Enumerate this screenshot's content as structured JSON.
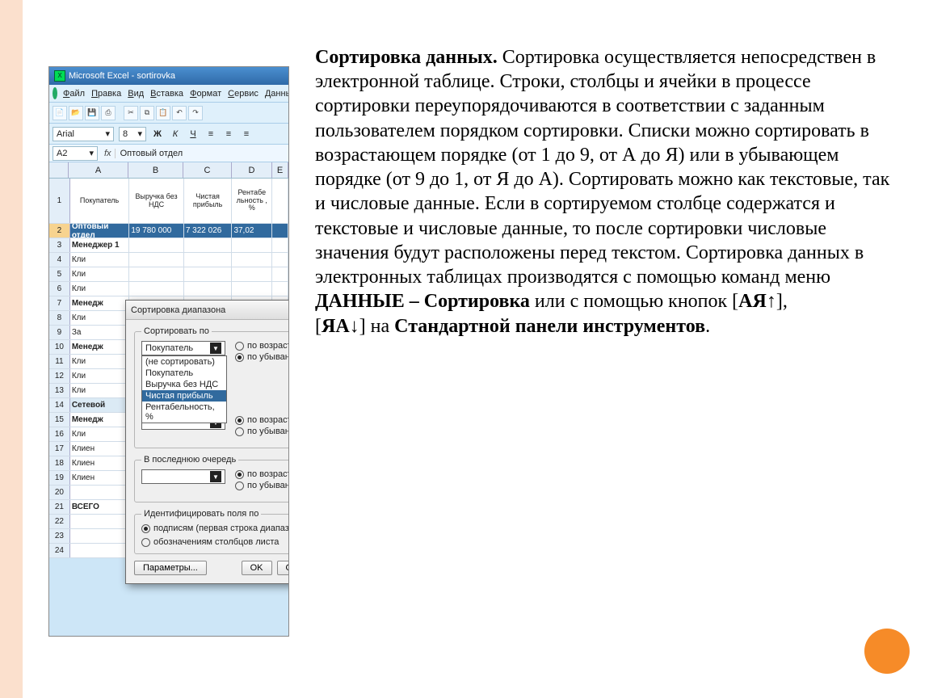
{
  "slide_text": {
    "t1_b": "Сортировка данных.",
    "t1": " Сортировка осуществляется непосредствен в электронной таблице. Строки, столбцы и ячейки в процессе сортировки переупорядочиваются в соответствии с заданным пользователем порядком сортировки. Списки можно сортировать в возрастающем порядке (от 1 до 9, от А до Я) или в убывающем порядке (от 9 до 1, от Я до А). Сортировать можно как текстовые, так и числовые данные. Если в сортируемом столбце содержатся и текстовые и числовые данные, то после сортировки числовые значения будут расположены перед текстом. Сортировка данных в электронных таблицах производятся с помощью команд меню ",
    "t2_b": "ДАННЫЕ – Сортировка",
    "t2": " или с помощью кнопок [",
    "t3_b": "АЯ↑",
    "t3": "],",
    "lb": "[",
    "t4_b": "ЯА↓",
    "t4": "] на ",
    "t5_b": "Стандартной панели инструментов",
    "t5": "."
  },
  "excel": {
    "title": "Microsoft Excel - sortirovka",
    "menus": [
      "Файл",
      "Правка",
      "Вид",
      "Вставка",
      "Формат",
      "Сервис",
      "Данны"
    ],
    "font_name": "Arial",
    "font_size": "8",
    "cell_ref": "A2",
    "cell_val": "Оптовый отдел",
    "col_labels": [
      "A",
      "B",
      "C",
      "D",
      "E"
    ],
    "header_row": [
      "Покупатель",
      "Выручка без НДС",
      "Чистая прибыль",
      "Рентабе льность , %"
    ],
    "data": [
      [
        "Оптовый отдел",
        "19 780 000",
        "7 322 026",
        "37,02"
      ],
      [
        "Менеджер 1",
        "",
        "",
        ""
      ],
      [
        "Кли",
        "",
        "",
        ""
      ],
      [
        "Кли",
        "",
        "",
        ""
      ],
      [
        "Кли",
        "",
        "",
        ""
      ],
      [
        "Менедж",
        "",
        "",
        ""
      ],
      [
        "Кли",
        "",
        "",
        ""
      ],
      [
        "За",
        "",
        "",
        ""
      ],
      [
        "Менедж",
        "",
        "",
        ""
      ],
      [
        "Кли",
        "",
        "",
        ""
      ],
      [
        "Кли",
        "",
        "",
        ""
      ],
      [
        "Кли",
        "",
        "",
        ""
      ],
      [
        "Сетевой",
        "",
        "",
        ""
      ],
      [
        "Менедж",
        "",
        "",
        ""
      ],
      [
        "Кли",
        "",
        "",
        ""
      ],
      [
        "Клиен",
        "",
        "",
        ""
      ],
      [
        "Клиен",
        "",
        "",
        ""
      ],
      [
        "Клиен",
        "",
        "",
        ""
      ],
      [
        "",
        "",
        "",
        ""
      ],
      [
        "ВСЕГО",
        "",
        "",
        ""
      ],
      [
        "",
        "",
        "",
        ""
      ],
      [
        "",
        "",
        "",
        ""
      ],
      [
        "",
        "",
        "",
        ""
      ]
    ]
  },
  "dialog": {
    "title": "Сортировка диапазона",
    "grp1": "Сортировать по",
    "combo1": "Покупатель",
    "options": [
      "(не сортировать)",
      "Покупатель",
      "Выручка без НДС",
      "Чистая прибыль",
      "Рентабельность, %"
    ],
    "r_asc": "по возрастанию",
    "r_desc": "по убыванию",
    "grp3": "В последнюю очередь",
    "grp4": "Идентифицировать поля по",
    "id1": "подписям (первая строка диапазона)",
    "id2": "обозначениям столбцов листа",
    "btn_params": "Параметры...",
    "btn_ok": "OK",
    "btn_cancel": "Отмена"
  }
}
